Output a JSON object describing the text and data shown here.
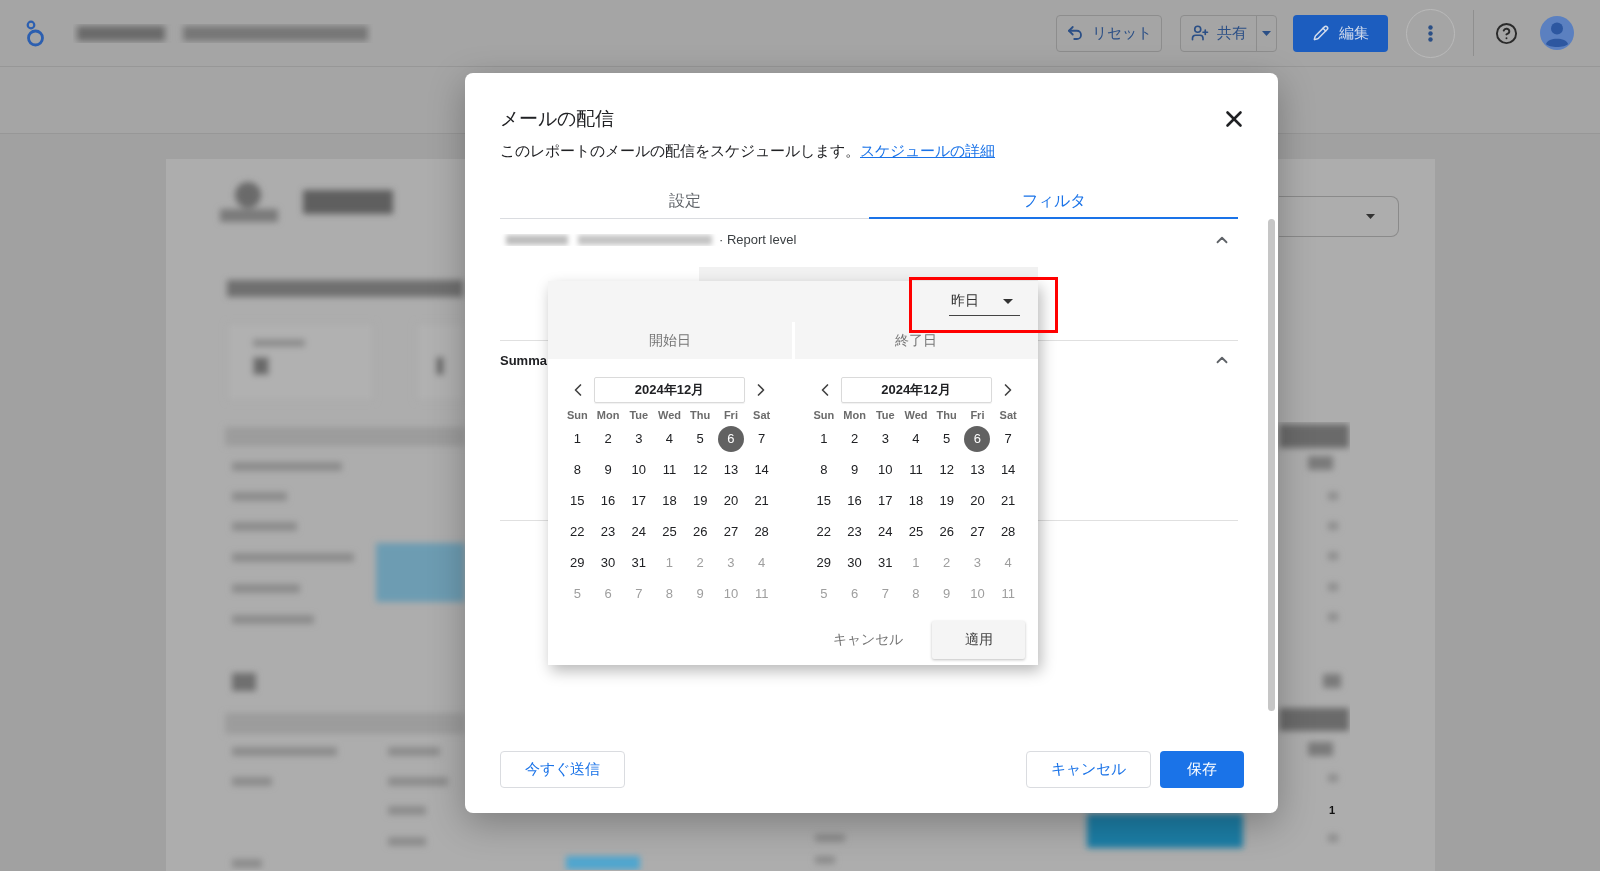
{
  "app_bar": {
    "buttons": [
      {
        "kind": "reset",
        "label": "リセット"
      },
      {
        "kind": "share",
        "label": "共有"
      },
      {
        "kind": "edit",
        "label": "編集"
      }
    ]
  },
  "report": {
    "table_value": "1"
  },
  "dialog": {
    "title": "メールの配信",
    "description": "このレポートのメールの配信をスケジュールします。",
    "link": "スケジュールの詳細",
    "tabs": [
      {
        "label": "設定",
        "selected": false
      },
      {
        "label": "フィルタ",
        "selected": true
      }
    ],
    "sections": [
      {
        "kind": "report_level",
        "label": "· Report level",
        "expanded": true
      },
      {
        "kind": "heading",
        "label": "Summa",
        "expanded": true
      }
    ],
    "footer": {
      "left": [
        {
          "kind": "outlined",
          "label": "今すぐ送信"
        }
      ],
      "right": [
        {
          "kind": "outlined",
          "label": "キャンセル"
        },
        {
          "kind": "filled",
          "label": "保存"
        }
      ]
    }
  },
  "date_picker": {
    "preset": {
      "value": "昨日",
      "highlighted": true
    },
    "calendars": [
      {
        "label": "開始日",
        "month": "2024年12月",
        "weekdays": [
          "Sun",
          "Mon",
          "Tue",
          "Wed",
          "Thu",
          "Fri",
          "Sat"
        ],
        "weeks": [
          [
            {
              "day": "1",
              "outside": false,
              "selected": false
            },
            {
              "day": "2",
              "outside": false,
              "selected": false
            },
            {
              "day": "3",
              "outside": false,
              "selected": false
            },
            {
              "day": "4",
              "outside": false,
              "selected": false
            },
            {
              "day": "5",
              "outside": false,
              "selected": false
            },
            {
              "day": "6",
              "outside": false,
              "selected": true
            },
            {
              "day": "7",
              "outside": false,
              "selected": false
            }
          ],
          [
            {
              "day": "8",
              "outside": false,
              "selected": false
            },
            {
              "day": "9",
              "outside": false,
              "selected": false
            },
            {
              "day": "10",
              "outside": false,
              "selected": false
            },
            {
              "day": "11",
              "outside": false,
              "selected": false
            },
            {
              "day": "12",
              "outside": false,
              "selected": false
            },
            {
              "day": "13",
              "outside": false,
              "selected": false
            },
            {
              "day": "14",
              "outside": false,
              "selected": false
            }
          ],
          [
            {
              "day": "15",
              "outside": false,
              "selected": false
            },
            {
              "day": "16",
              "outside": false,
              "selected": false
            },
            {
              "day": "17",
              "outside": false,
              "selected": false
            },
            {
              "day": "18",
              "outside": false,
              "selected": false
            },
            {
              "day": "19",
              "outside": false,
              "selected": false
            },
            {
              "day": "20",
              "outside": false,
              "selected": false
            },
            {
              "day": "21",
              "outside": false,
              "selected": false
            }
          ],
          [
            {
              "day": "22",
              "outside": false,
              "selected": false
            },
            {
              "day": "23",
              "outside": false,
              "selected": false
            },
            {
              "day": "24",
              "outside": false,
              "selected": false
            },
            {
              "day": "25",
              "outside": false,
              "selected": false
            },
            {
              "day": "26",
              "outside": false,
              "selected": false
            },
            {
              "day": "27",
              "outside": false,
              "selected": false
            },
            {
              "day": "28",
              "outside": false,
              "selected": false
            }
          ],
          [
            {
              "day": "29",
              "outside": false,
              "selected": false
            },
            {
              "day": "30",
              "outside": false,
              "selected": false
            },
            {
              "day": "31",
              "outside": false,
              "selected": false
            },
            {
              "day": "1",
              "outside": true,
              "selected": false
            },
            {
              "day": "2",
              "outside": true,
              "selected": false
            },
            {
              "day": "3",
              "outside": true,
              "selected": false
            },
            {
              "day": "4",
              "outside": true,
              "selected": false
            }
          ],
          [
            {
              "day": "5",
              "outside": true,
              "selected": false
            },
            {
              "day": "6",
              "outside": true,
              "selected": false
            },
            {
              "day": "7",
              "outside": true,
              "selected": false
            },
            {
              "day": "8",
              "outside": true,
              "selected": false
            },
            {
              "day": "9",
              "outside": true,
              "selected": false
            },
            {
              "day": "10",
              "outside": true,
              "selected": false
            },
            {
              "day": "11",
              "outside": true,
              "selected": false
            }
          ]
        ]
      },
      {
        "label": "終了日",
        "month": "2024年12月",
        "weekdays": [
          "Sun",
          "Mon",
          "Tue",
          "Wed",
          "Thu",
          "Fri",
          "Sat"
        ],
        "weeks": [
          [
            {
              "day": "1",
              "outside": false,
              "selected": false
            },
            {
              "day": "2",
              "outside": false,
              "selected": false
            },
            {
              "day": "3",
              "outside": false,
              "selected": false
            },
            {
              "day": "4",
              "outside": false,
              "selected": false
            },
            {
              "day": "5",
              "outside": false,
              "selected": false
            },
            {
              "day": "6",
              "outside": false,
              "selected": true
            },
            {
              "day": "7",
              "outside": false,
              "selected": false
            }
          ],
          [
            {
              "day": "8",
              "outside": false,
              "selected": false
            },
            {
              "day": "9",
              "outside": false,
              "selected": false
            },
            {
              "day": "10",
              "outside": false,
              "selected": false
            },
            {
              "day": "11",
              "outside": false,
              "selected": false
            },
            {
              "day": "12",
              "outside": false,
              "selected": false
            },
            {
              "day": "13",
              "outside": false,
              "selected": false
            },
            {
              "day": "14",
              "outside": false,
              "selected": false
            }
          ],
          [
            {
              "day": "15",
              "outside": false,
              "selected": false
            },
            {
              "day": "16",
              "outside": false,
              "selected": false
            },
            {
              "day": "17",
              "outside": false,
              "selected": false
            },
            {
              "day": "18",
              "outside": false,
              "selected": false
            },
            {
              "day": "19",
              "outside": false,
              "selected": false
            },
            {
              "day": "20",
              "outside": false,
              "selected": false
            },
            {
              "day": "21",
              "outside": false,
              "selected": false
            }
          ],
          [
            {
              "day": "22",
              "outside": false,
              "selected": false
            },
            {
              "day": "23",
              "outside": false,
              "selected": false
            },
            {
              "day": "24",
              "outside": false,
              "selected": false
            },
            {
              "day": "25",
              "outside": false,
              "selected": false
            },
            {
              "day": "26",
              "outside": false,
              "selected": false
            },
            {
              "day": "27",
              "outside": false,
              "selected": false
            },
            {
              "day": "28",
              "outside": false,
              "selected": false
            }
          ],
          [
            {
              "day": "29",
              "outside": false,
              "selected": false
            },
            {
              "day": "30",
              "outside": false,
              "selected": false
            },
            {
              "day": "31",
              "outside": false,
              "selected": false
            },
            {
              "day": "1",
              "outside": true,
              "selected": false
            },
            {
              "day": "2",
              "outside": true,
              "selected": false
            },
            {
              "day": "3",
              "outside": true,
              "selected": false
            },
            {
              "day": "4",
              "outside": true,
              "selected": false
            }
          ],
          [
            {
              "day": "5",
              "outside": true,
              "selected": false
            },
            {
              "day": "6",
              "outside": true,
              "selected": false
            },
            {
              "day": "7",
              "outside": true,
              "selected": false
            },
            {
              "day": "8",
              "outside": true,
              "selected": false
            },
            {
              "day": "9",
              "outside": true,
              "selected": false
            },
            {
              "day": "10",
              "outside": true,
              "selected": false
            },
            {
              "day": "11",
              "outside": true,
              "selected": false
            }
          ]
        ]
      }
    ],
    "cancel": "キャンセル",
    "apply": "適用"
  }
}
